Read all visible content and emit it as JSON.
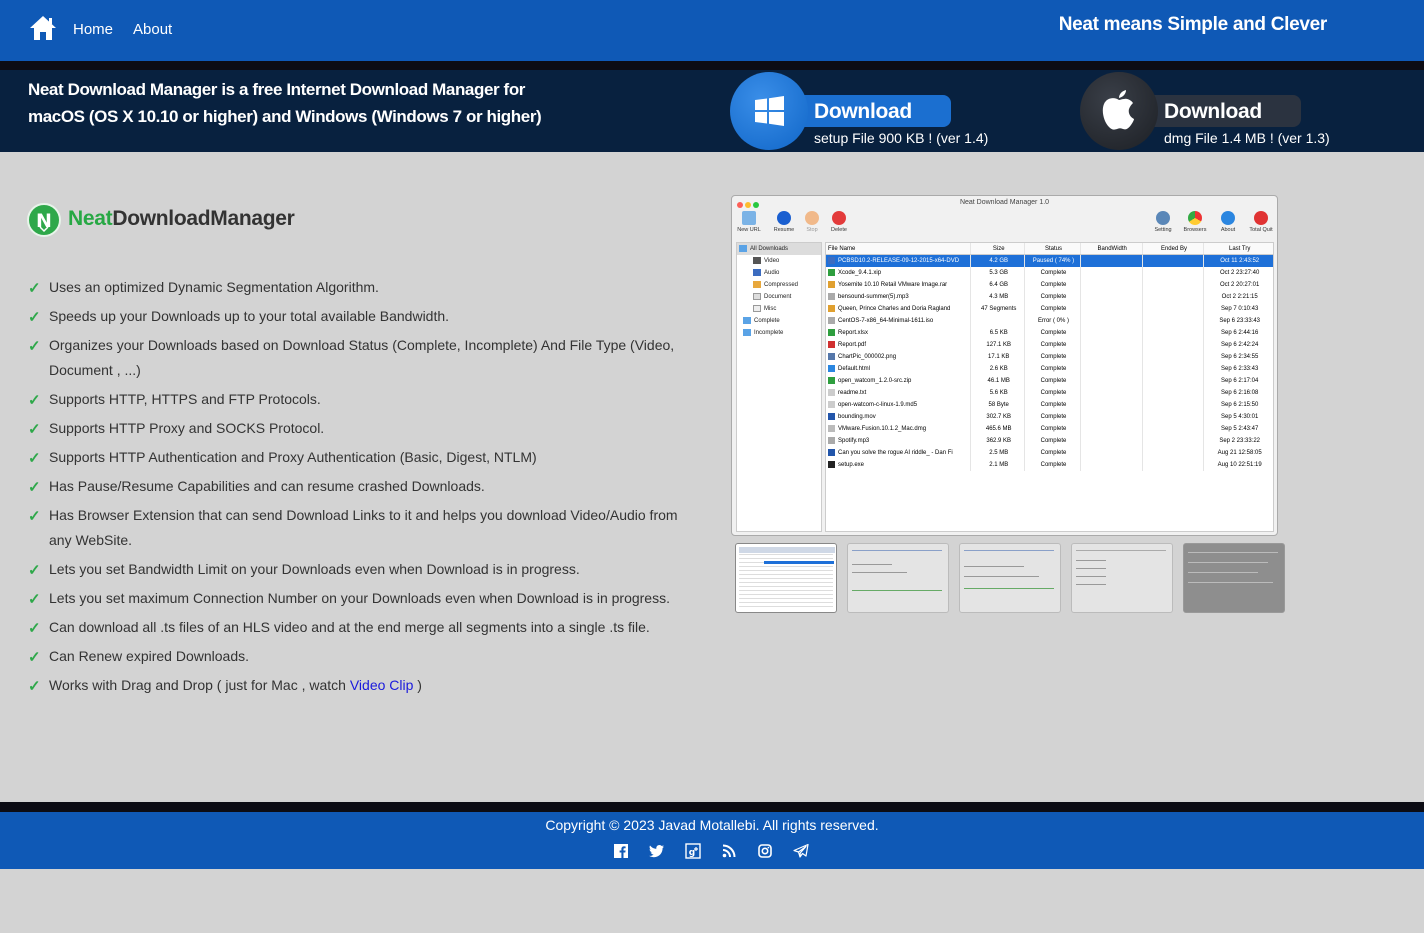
{
  "nav": {
    "home": "Home",
    "about": "About",
    "tagline": "Neat means Simple and Clever"
  },
  "hero": {
    "line1": "Neat Download Manager is a free Internet Download Manager for",
    "line2": "macOS (OS X 10.10  or higher) and Windows (Windows 7 or higher)",
    "windows": {
      "label": "Download",
      "sub": "setup File 900 KB ! (ver 1.4)",
      "icon": "windows-logo-icon"
    },
    "mac": {
      "label": "Download",
      "sub": "dmg File 1.4 MB !  (ver 1.3)",
      "icon": "apple-logo-icon"
    }
  },
  "brand": {
    "part1": "Neat",
    "part2": "DownloadManager",
    "logo_letter": "N"
  },
  "features": [
    "Uses an optimized Dynamic Segmentation Algorithm.",
    "Speeds up your Downloads up to your total available Bandwidth.",
    "Organizes your Downloads based on Download Status (Complete, Incomplete) And File Type (Video, Document , ...)",
    "Supports HTTP, HTTPS and FTP Protocols.",
    "Supports HTTP Proxy and SOCKS Protocol.",
    "Supports HTTP Authentication and Proxy Authentication (Basic, Digest, NTLM)",
    "Has Pause/Resume Capabilities and can resume crashed Downloads.",
    "Has Browser Extension that can send Download Links to it and helps you download Video/Audio from any WebSite.",
    "Lets you set Bandwidth Limit on your Downloads even when Download is in progress.",
    "Lets you set maximum Connection Number on your Downloads even when Download is in progress.",
    "Can download all .ts files of an HLS video and at the end merge all segments into a single .ts file.",
    "Can Renew expired Downloads."
  ],
  "last_feature": {
    "prefix": "Works with Drag and Drop ( just for Mac , watch ",
    "link": "Video Clip",
    "suffix": " )"
  },
  "screenshot": {
    "title": "Neat Download Manager 1.0",
    "toolbar_left": [
      "New URL",
      "Resume",
      "Stop",
      "Delete"
    ],
    "toolbar_right": [
      "Setting",
      "Browsers",
      "About",
      "Total Quit"
    ],
    "sidebar": [
      "All Downloads",
      "Video",
      "Audio",
      "Compressed",
      "Document",
      "Misc",
      "Complete",
      "Incomplete"
    ],
    "columns": [
      "File Name",
      "Size",
      "Status",
      "BandWidth",
      "Ended By",
      "Last Try"
    ],
    "rows": [
      [
        "PCBSD10.2-RELEASE-09-12-2015-x64-DVD",
        "4.2 GB",
        "Paused ( 74% )",
        "",
        "",
        "Oct 11  2:43:52"
      ],
      [
        "Xcode_9.4.1.xip",
        "5.3 GB",
        "Complete",
        "",
        "",
        "Oct 2  23:27:40"
      ],
      [
        "Yosemite 10.10 Retail VMware Image.rar",
        "6.4 GB",
        "Complete",
        "",
        "",
        "Oct 2  20:27:01"
      ],
      [
        "bensound-summer(5).mp3",
        "4.3 MB",
        "Complete",
        "",
        "",
        "Oct 2  2:21:15"
      ],
      [
        "Queen, Prince Charles and Doria Ragland",
        "47 Segments",
        "Complete",
        "",
        "",
        "Sep 7  0:10:43"
      ],
      [
        "CentOS-7-x86_64-Minimal-1611.iso",
        "",
        "Error ( 0% )",
        "",
        "",
        "Sep 6  23:33:43"
      ],
      [
        "Report.xlsx",
        "6.5 KB",
        "Complete",
        "",
        "",
        "Sep 6  2:44:16"
      ],
      [
        "Report.pdf",
        "127.1 KB",
        "Complete",
        "",
        "",
        "Sep 6  2:42:24"
      ],
      [
        "ChartPic_000002.png",
        "17.1 KB",
        "Complete",
        "",
        "",
        "Sep 6  2:34:55"
      ],
      [
        "Default.html",
        "2.6 KB",
        "Complete",
        "",
        "",
        "Sep 6  2:33:43"
      ],
      [
        "open_watcom_1.2.0-src.zip",
        "46.1 MB",
        "Complete",
        "",
        "",
        "Sep 6  2:17:04"
      ],
      [
        "readme.txt",
        "5.6 KB",
        "Complete",
        "",
        "",
        "Sep 6  2:16:08"
      ],
      [
        "open-watcom-c-linux-1.9.md5",
        "58 Byte",
        "Complete",
        "",
        "",
        "Sep 6  2:15:50"
      ],
      [
        "bounding.mov",
        "302.7 KB",
        "Complete",
        "",
        "",
        "Sep 5  4:30:01"
      ],
      [
        "VMware.Fusion.10.1.2_Mac.dmg",
        "465.6 MB",
        "Complete",
        "",
        "",
        "Sep 5  2:43:47"
      ],
      [
        "Spotify.mp3",
        "362.9 KB",
        "Complete",
        "",
        "",
        "Sep 2  23:33:22"
      ],
      [
        "Can you solve the rogue AI riddle_ - Dan Fi",
        "2.5 MB",
        "Complete",
        "",
        "",
        "Aug 21  12:58:05"
      ],
      [
        "setup.exe",
        "2.1 MB",
        "Complete",
        "",
        "",
        "Aug 10  22:51:19"
      ]
    ]
  },
  "footer": {
    "copyright": "Copyright © 2023 Javad Motallebi. All rights reserved."
  },
  "social_icons": [
    "facebook-icon",
    "twitter-icon",
    "google-plus-icon",
    "rss-icon",
    "instagram-icon",
    "telegram-icon"
  ],
  "colors": {
    "nav_blue": "#0f59b6",
    "hero_navy": "#08213f",
    "brand_green": "#27a844",
    "selection_blue": "#1e70d8"
  }
}
